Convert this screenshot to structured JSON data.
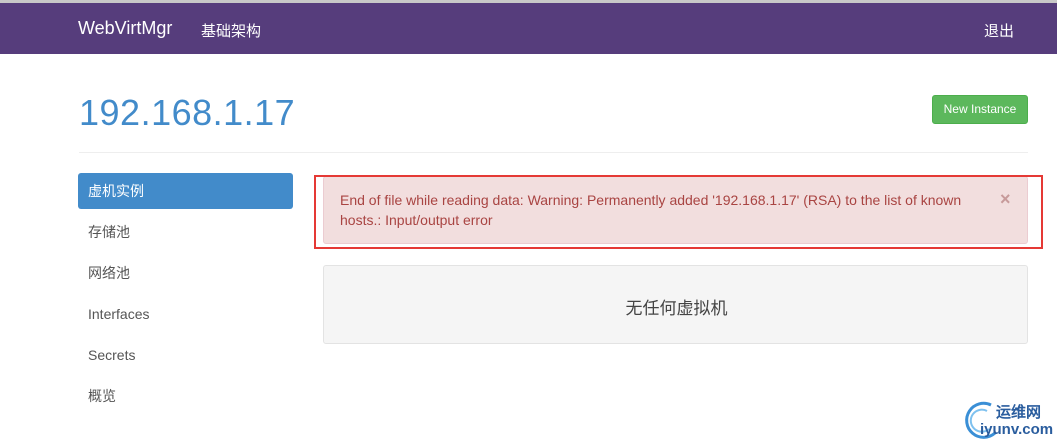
{
  "navbar": {
    "brand": "WebVirtMgr",
    "infrastructure_link": "基础架构",
    "logout_link": "退出"
  },
  "page": {
    "title": "192.168.1.17",
    "new_instance_button": "New Instance"
  },
  "sidebar": {
    "items": [
      {
        "label": "虚机实例",
        "active": true
      },
      {
        "label": "存储池",
        "active": false
      },
      {
        "label": "网络池",
        "active": false
      },
      {
        "label": "Interfaces",
        "active": false
      },
      {
        "label": "Secrets",
        "active": false
      },
      {
        "label": "概览",
        "active": false
      }
    ]
  },
  "alert": {
    "message": "End of file while reading data: Warning: Permanently added '192.168.1.17' (RSA) to the list of known hosts.: Input/output error",
    "close": "×"
  },
  "instances": {
    "empty_message": "无任何虚拟机"
  },
  "watermark": {
    "title": "运维网",
    "url": "iyunv.com"
  },
  "colors": {
    "navbar": "#563d7c",
    "title": "#428bca",
    "success_button": "#5cb85c",
    "active_item": "#428bca",
    "alert_bg": "#f2dede",
    "alert_text": "#a94442",
    "highlight": "#e53935"
  }
}
